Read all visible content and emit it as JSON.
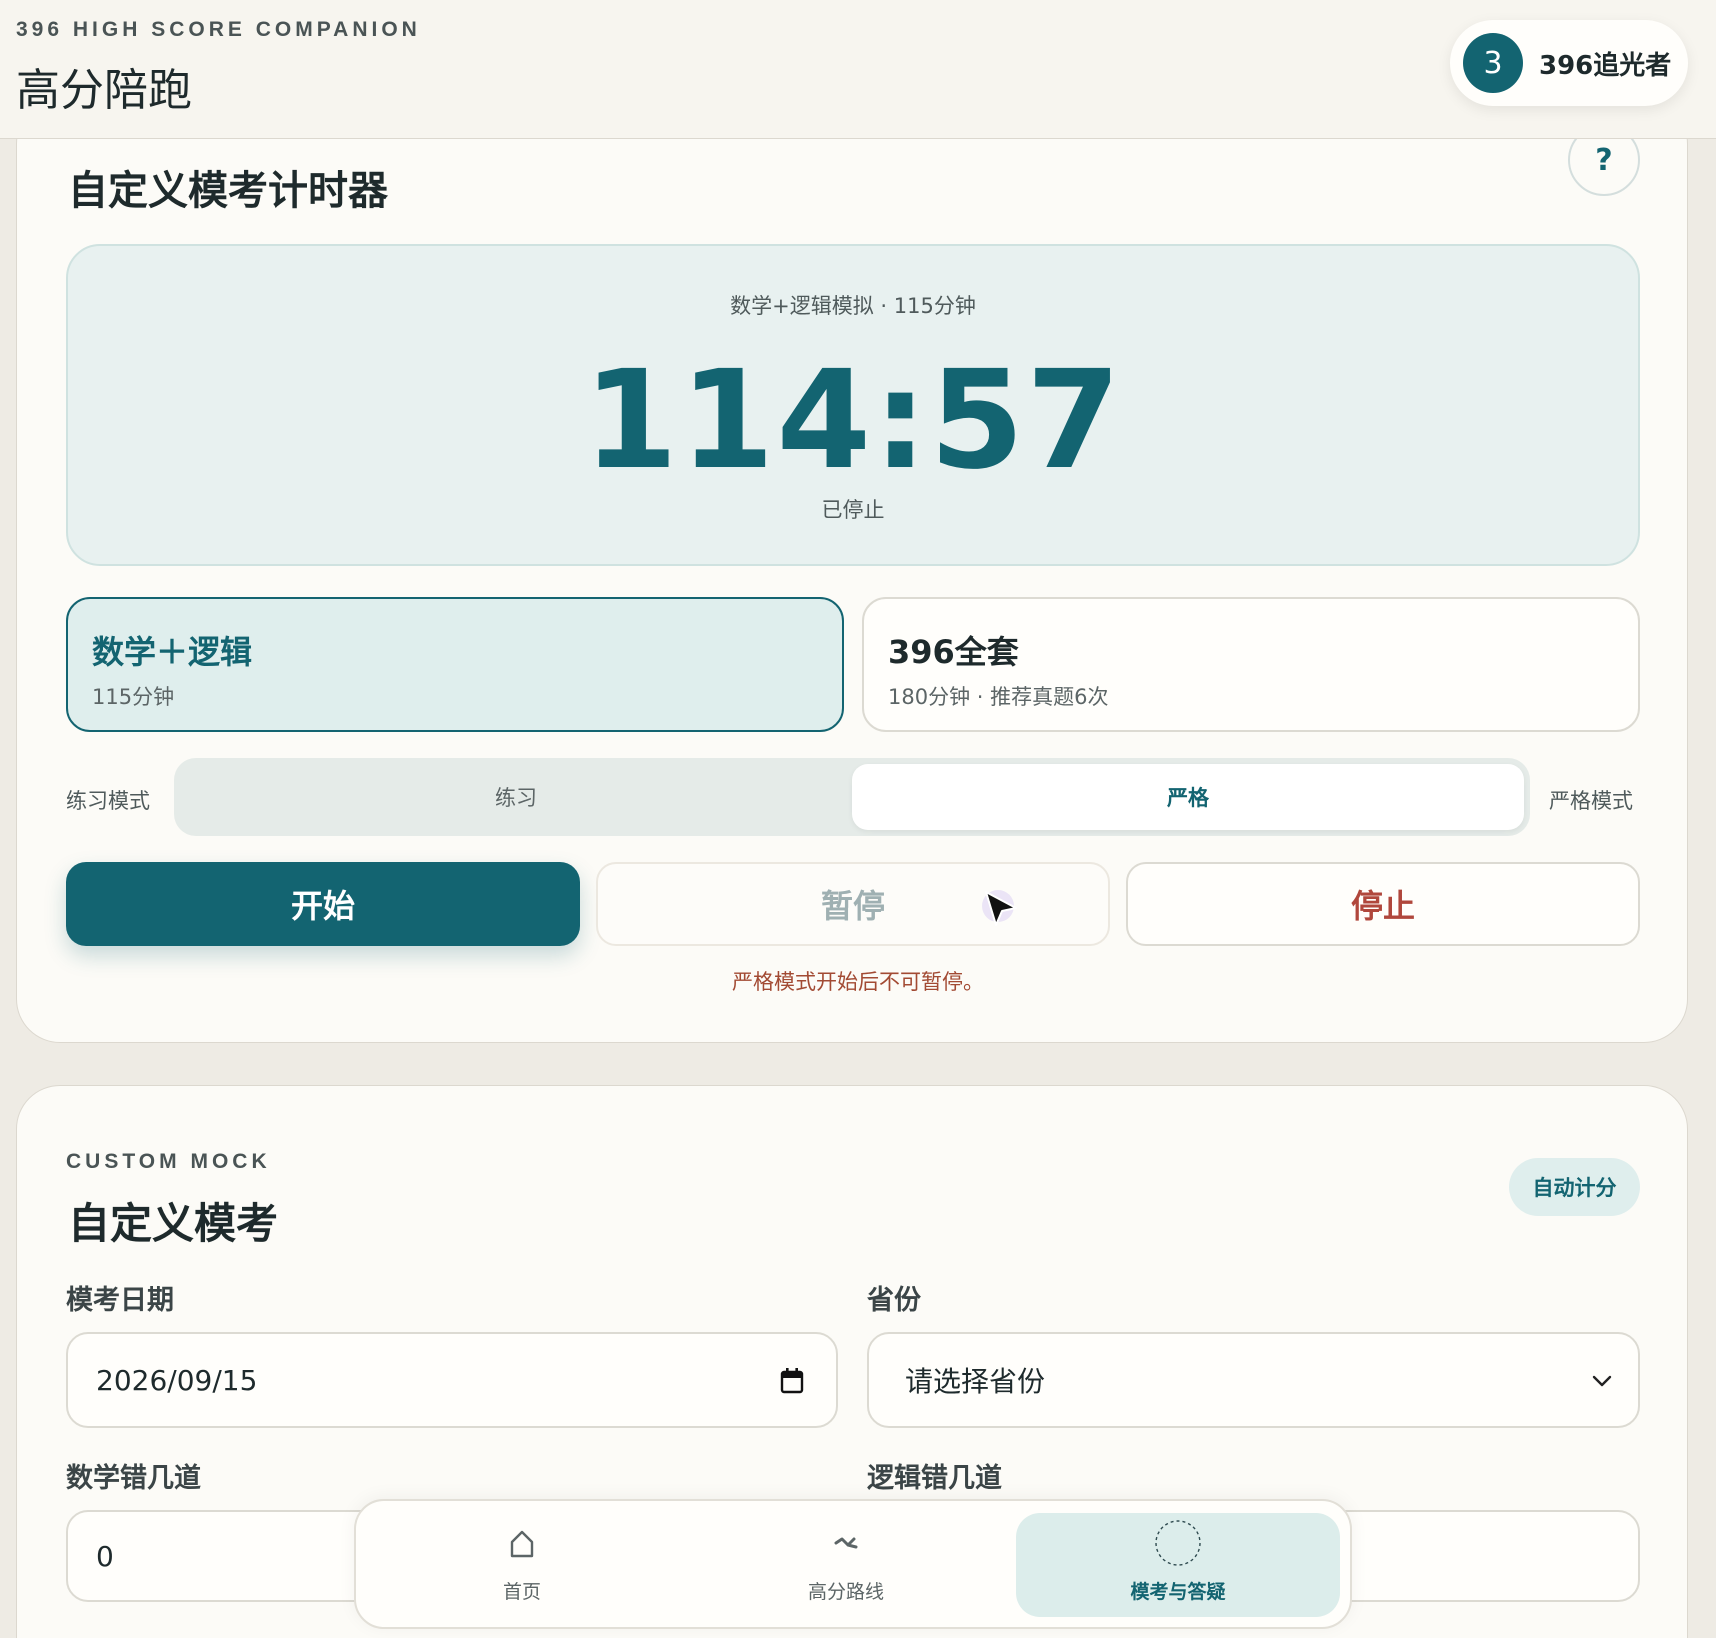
{
  "header": {
    "brand_sub": "396 HIGH SCORE COMPANION",
    "brand_title": "高分陪跑",
    "user": {
      "level": "3",
      "name": "396追光者"
    }
  },
  "timer": {
    "section_title": "自定义模考计时器",
    "help_label": "?",
    "subtitle": "数学+逻辑模拟 · 115分钟",
    "time": "114:57",
    "status": "已停止",
    "presets": [
      {
        "name": "数学＋逻辑",
        "desc": "115分钟",
        "active": true
      },
      {
        "name": "396全套",
        "desc": "180分钟 · 推荐真题6次",
        "active": false
      }
    ],
    "mode_label_left": "练习模式",
    "mode_label_right": "严格模式",
    "mode_options": {
      "practice": "练习",
      "strict": "严格"
    },
    "selected_mode": "strict",
    "buttons": {
      "start": "开始",
      "pause": "暂停",
      "stop": "停止"
    },
    "warning": "严格模式开始后不可暂停。"
  },
  "mock": {
    "eyebrow": "CUSTOM MOCK",
    "title": "自定义模考",
    "auto_badge": "自动计分",
    "date_label": "模考日期",
    "date_value": "2026/09/15",
    "province_label": "省份",
    "province_placeholder": "请选择省份",
    "math_label": "数学错几道",
    "math_value": "0",
    "logic_label": "逻辑错几道"
  },
  "nav": {
    "items": [
      {
        "label": "首页",
        "icon": "home-icon"
      },
      {
        "label": "高分路线",
        "icon": "route-icon"
      },
      {
        "label": "模考与答疑",
        "icon": "loading-circle-icon",
        "active": true
      }
    ]
  },
  "colors": {
    "accent": "#136471",
    "accent_light": "#dfeeed",
    "danger": "#b0473c",
    "warning_text": "#a24a33",
    "background": "#eeebe4",
    "card": "#fcfbf7"
  }
}
